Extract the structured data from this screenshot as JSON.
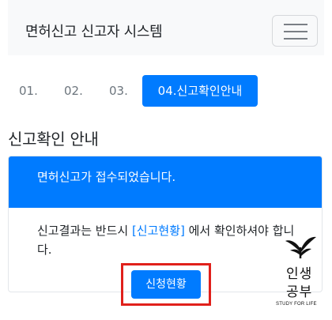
{
  "navbar": {
    "brand": "면허신고 신고자 시스템",
    "toggler_icon": "hamburger-icon"
  },
  "steps": [
    {
      "label": "01."
    },
    {
      "label": "02."
    },
    {
      "label": "03."
    },
    {
      "label": "04.신고확인안내",
      "active": true
    }
  ],
  "section": {
    "title": "신고확인 안내"
  },
  "card": {
    "header": "면허신고가 접수되었습니다.",
    "body_prefix": "신고결과는 반드시 ",
    "body_link": "[신고현황]",
    "body_suffix": " 에서 확인하셔야 합니다.",
    "button_label": "신청현황"
  },
  "watermark": {
    "line1": "인생",
    "line2": "공부",
    "tagline": "STUDY FOR LIFE"
  },
  "colors": {
    "primary": "#007bff",
    "highlight": "#e0201b",
    "navbar_bg": "#f8f9fa"
  }
}
